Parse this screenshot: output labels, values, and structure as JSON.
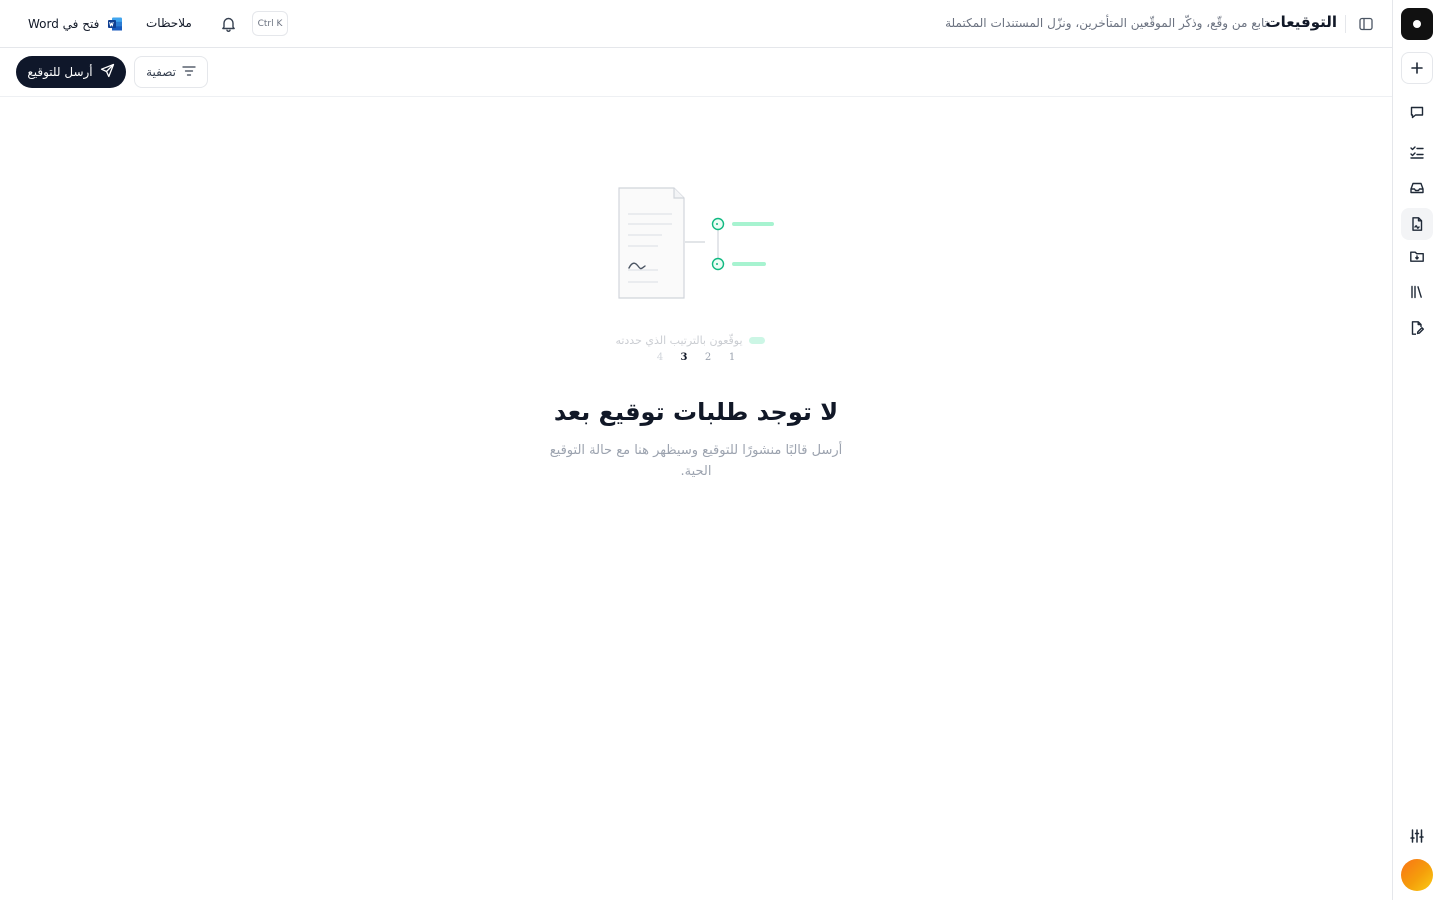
{
  "header": {
    "title": "التوقيعات",
    "description": "تابع من وقّع، وذكّر الموقّعين المتأخرين، ونزّل المستندات المكتملة",
    "shortcut": "Ctrl K",
    "notes_label": "ملاحظات",
    "open_in_word_label": "فتح في Word"
  },
  "toolbar": {
    "send_label": "أرسل للتوقيع",
    "filter_label": "تصفية"
  },
  "empty_state": {
    "illustration_caption": "يوقّعون بالترتيب الذي حددته",
    "steps": [
      "1",
      "2",
      "3",
      "4"
    ],
    "current_step": "3",
    "title": "لا توجد طلبات توقيع بعد",
    "description": "أرسل قالبًا منشورًا للتوقيع وسيظهر هنا مع حالة التوقيع الحية."
  },
  "rail": {
    "items": [
      "logo-icon",
      "new-icon",
      "chat-icon",
      "checklist-icon",
      "inbox-icon",
      "signature-document-icon",
      "folder-icon",
      "library-icon",
      "edit-document-icon",
      "settings-sliders-icon",
      "user-avatar"
    ],
    "active_item": "signature-document-icon"
  },
  "colors": {
    "primary": "#0f172a",
    "accent_green": "#10b981",
    "accent_green_light": "#a7f3d0",
    "border": "#e5e7eb",
    "muted_text": "#9ca3af",
    "avatar_gradient": [
      "#f97316",
      "#facc15"
    ]
  }
}
